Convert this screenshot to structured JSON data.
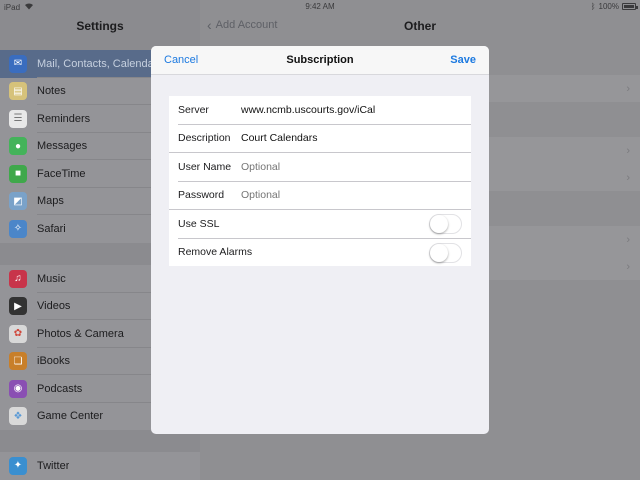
{
  "status": {
    "carrier": "iPad",
    "time": "9:42 AM",
    "battery": "100%",
    "battery_level": 1.0
  },
  "sidebar": {
    "title": "Settings",
    "group1": [
      {
        "label": "Mail, Contacts, Calendars",
        "icon": "mail-icon",
        "color": "#3a6dbf",
        "selected": true
      },
      {
        "label": "Notes",
        "icon": "notes-icon",
        "color": "#d6c27a"
      },
      {
        "label": "Reminders",
        "icon": "reminders-icon",
        "color": "#e8e8e8"
      },
      {
        "label": "Messages",
        "icon": "messages-icon",
        "color": "#44b35a"
      },
      {
        "label": "FaceTime",
        "icon": "facetime-icon",
        "color": "#3fa84b"
      },
      {
        "label": "Maps",
        "icon": "maps-icon",
        "color": "#7aa2c9"
      },
      {
        "label": "Safari",
        "icon": "safari-icon",
        "color": "#4b86c9"
      }
    ],
    "group2": [
      {
        "label": "Music",
        "icon": "music-icon",
        "color": "#c8344a"
      },
      {
        "label": "Videos",
        "icon": "videos-icon",
        "color": "#333333"
      },
      {
        "label": "Photos & Camera",
        "icon": "photos-icon",
        "color": "#d8d8d8"
      },
      {
        "label": "iBooks",
        "icon": "ibooks-icon",
        "color": "#c87f2a"
      },
      {
        "label": "Podcasts",
        "icon": "podcasts-icon",
        "color": "#8a4fb3"
      },
      {
        "label": "Game Center",
        "icon": "game-center-icon",
        "color": "#d9d9d9"
      }
    ],
    "group3": [
      {
        "label": "Twitter",
        "icon": "twitter-icon",
        "color": "#3a8fd0"
      }
    ]
  },
  "detail": {
    "back_label": "Add Account",
    "title": "Other"
  },
  "modal": {
    "cancel_label": "Cancel",
    "title": "Subscription",
    "save_label": "Save",
    "server_label": "Server",
    "server_value": "www.ncmb.uscourts.gov/iCal",
    "description_label": "Description",
    "description_value": "Court Calendars",
    "username_label": "User Name",
    "username_placeholder": "Optional",
    "password_label": "Password",
    "password_placeholder": "Optional",
    "ssl_label": "Use SSL",
    "ssl_on": false,
    "alarms_label": "Remove Alarms",
    "alarms_on": false
  }
}
